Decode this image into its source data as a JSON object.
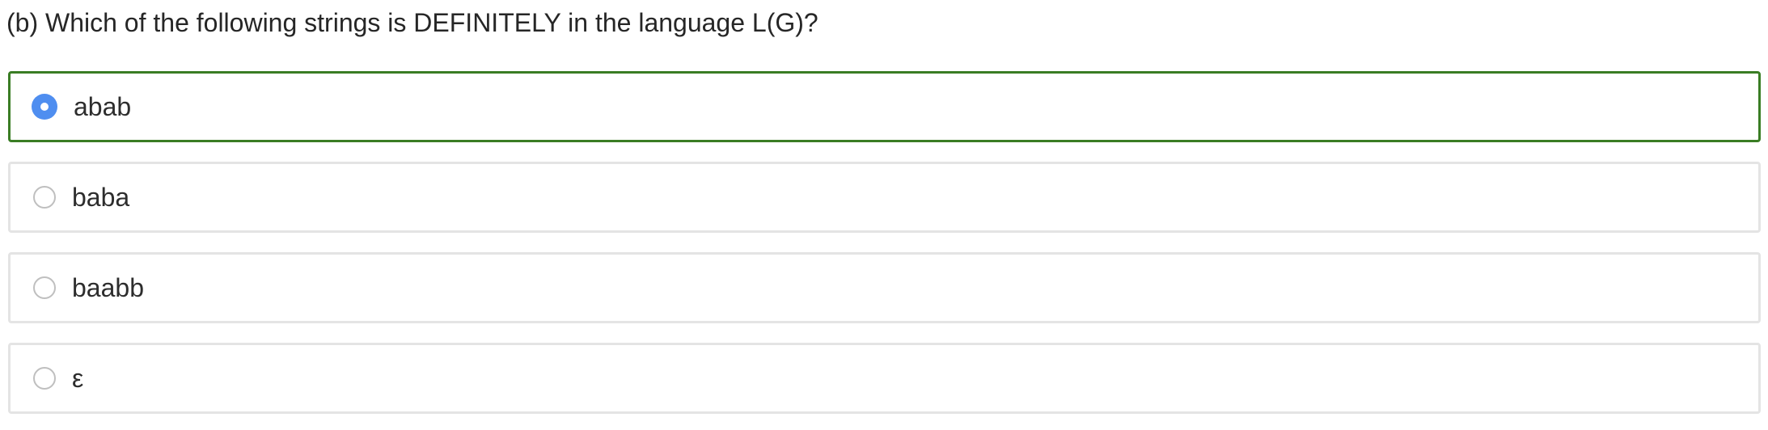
{
  "question": {
    "text": "(b) Which of the following strings is DEFINITELY in the language L(G)?"
  },
  "options": [
    {
      "label": "abab",
      "selected": true
    },
    {
      "label": "baba",
      "selected": false
    },
    {
      "label": "baabb",
      "selected": false
    },
    {
      "label": "ε",
      "selected": false
    }
  ],
  "colors": {
    "selected_border": "#3a7d24",
    "unselected_border": "#e4e4e4",
    "radio_selected": "#4f8ef0",
    "radio_unselected": "#bfbfbf"
  }
}
